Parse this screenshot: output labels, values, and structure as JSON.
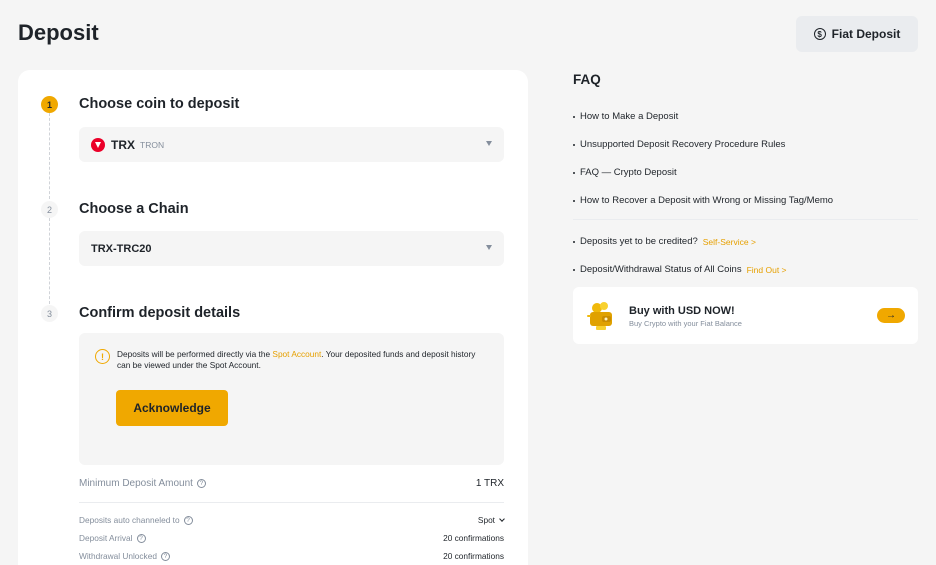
{
  "header": {
    "title": "Deposit",
    "fiat_button": "Fiat Deposit",
    "fiat_icon": "$"
  },
  "steps": [
    {
      "number": "1",
      "title": "Choose coin to deposit"
    },
    {
      "number": "2",
      "title": "Choose a Chain"
    },
    {
      "number": "3",
      "title": "Confirm deposit details"
    }
  ],
  "coin_select": {
    "symbol": "TRX",
    "name": "TRON",
    "icon": "tron-icon"
  },
  "chain_select": {
    "value": "TRX-TRC20"
  },
  "notice": {
    "icon": "!",
    "text_before": "Deposits will be performed directly via the ",
    "link": "Spot Account",
    "text_after": ". Your deposited funds and deposit history can be viewed under the Spot Account.",
    "button": "Acknowledge"
  },
  "details": {
    "min_label": "Minimum Deposit Amount",
    "min_value": "1 TRX",
    "channel_label": "Deposits auto channeled to",
    "channel_value": "Spot",
    "arrival_label": "Deposit Arrival",
    "arrival_value": "20 confirmations",
    "unlock_label": "Withdrawal Unlocked",
    "unlock_value": "20 confirmations",
    "help_icon": "?"
  },
  "faq": {
    "title": "FAQ",
    "items": [
      "How to Make a Deposit",
      "Unsupported Deposit Recovery Procedure Rules",
      "FAQ — Crypto Deposit",
      "How to Recover a Deposit with Wrong or Missing Tag/Memo"
    ],
    "pending_label": "Deposits yet to be credited?",
    "pending_link": "Self-Service >",
    "status_label": "Deposit/Withdrawal Status of All Coins",
    "status_link": "Find Out >"
  },
  "promo": {
    "title": "Buy with USD NOW!",
    "subtitle": "Buy Crypto with your Fiat Balance",
    "arrow": "→"
  },
  "colors": {
    "accent": "#f0a800",
    "link": "#e6a000",
    "tron_red": "#eb0029",
    "text_primary": "#1e2329",
    "text_secondary": "#848e9c"
  }
}
